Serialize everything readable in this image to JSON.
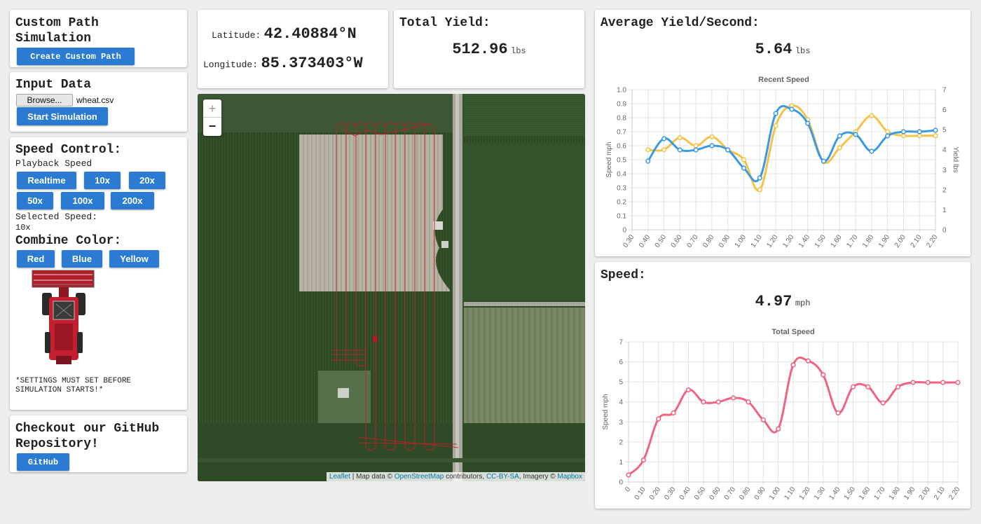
{
  "custom_path": {
    "title_line1": "Custom Path",
    "title_line2": "Simulation",
    "button": "Create Custom Path"
  },
  "input_data": {
    "title": "Input Data",
    "browse_label": "Browse...",
    "file_name": "wheat.csv",
    "start_button": "Start Simulation"
  },
  "speed_control": {
    "title": "Speed Control:",
    "playback_label": "Playback Speed",
    "buttons": [
      "Realtime",
      "10x",
      "20x",
      "50x",
      "100x",
      "200x"
    ],
    "selected_label": "Selected Speed:",
    "selected_value": "10x",
    "color_title": "Combine Color:",
    "color_buttons": [
      "Red",
      "Blue",
      "Yellow"
    ],
    "note_line1": "*SETTINGS MUST SET BEFORE",
    "note_line2": "SIMULATION STARTS!*"
  },
  "github": {
    "title_line1": "Checkout our GitHub",
    "title_line2": "Repository!",
    "button": "GitHub"
  },
  "coords": {
    "lat_label": "Latitude:",
    "lat_value": "42.40884°N",
    "lon_label": "Longitude:",
    "lon_value": "85.373403°W"
  },
  "total_yield": {
    "title": "Total Yield:",
    "value": "512.96",
    "unit": "lbs"
  },
  "avg_yield": {
    "title": "Average Yield/Second:",
    "value": "5.64",
    "unit": "lbs"
  },
  "speed": {
    "title": "Speed:",
    "value": "4.97",
    "unit": "mph"
  },
  "map": {
    "zoom_in": "+",
    "zoom_out": "−",
    "attr_leaflet": "Leaflet",
    "attr_text1": " | Map data © ",
    "attr_osm": "OpenStreetMap",
    "attr_text2": " contributors, ",
    "attr_license": "CC-BY-SA",
    "attr_text3": ", Imagery © ",
    "attr_mapbox": "Mapbox"
  },
  "colors": {
    "accent": "#2b7bd3",
    "yield_line": "#f5c24a",
    "speed_line_recent": "#3b9ae1",
    "speed_line_total": "#f06384",
    "path": "#c0202a"
  },
  "chart_data": [
    {
      "type": "line",
      "title": "Recent Speed",
      "ylabel": "Speed mph",
      "y2label": "Yield lbs",
      "categories": [
        "0.30",
        "0.40",
        "0.50",
        "0.60",
        "0.70",
        "0.80",
        "0.90",
        "1.00",
        "1.10",
        "1.20",
        "1.30",
        "1.40",
        "1.50",
        "1.60",
        "1.70",
        "1.80",
        "1.90",
        "2.00",
        "2.10",
        "2.20"
      ],
      "ylim": [
        0,
        1.0
      ],
      "y2lim": [
        0,
        7
      ],
      "yticks": [
        "0",
        "0.1",
        "0.2",
        "0.3",
        "0.4",
        "0.5",
        "0.6",
        "0.7",
        "0.8",
        "0.9",
        "1.0"
      ],
      "y2ticks": [
        "0",
        "1",
        "2",
        "3",
        "4",
        "5",
        "6",
        "7"
      ],
      "series": [
        {
          "axis": "right",
          "color": "#f5c24a",
          "values": [
            null,
            4.0,
            4.0,
            4.6,
            4.2,
            4.65,
            4.0,
            3.5,
            2.0,
            5.2,
            6.2,
            5.5,
            3.4,
            4.1,
            4.9,
            5.7,
            4.9,
            4.7,
            4.7,
            4.7
          ]
        },
        {
          "axis": "left",
          "color": "#3b9ae1",
          "values": [
            null,
            0.49,
            0.65,
            0.57,
            0.57,
            0.6,
            0.57,
            0.44,
            0.37,
            0.83,
            0.86,
            0.76,
            0.49,
            0.67,
            0.68,
            0.56,
            0.67,
            0.7,
            0.7,
            0.71
          ]
        }
      ],
      "grid": true
    },
    {
      "type": "line",
      "title": "Total Speed",
      "ylabel": "Speed mph",
      "categories": [
        "0",
        "0.10",
        "0.20",
        "0.30",
        "0.40",
        "0.50",
        "0.60",
        "0.70",
        "0.80",
        "0.90",
        "1.00",
        "1.10",
        "1.20",
        "1.30",
        "1.40",
        "1.50",
        "1.60",
        "1.70",
        "1.80",
        "1.90",
        "2.00",
        "2.10",
        "2.20"
      ],
      "ylim": [
        0,
        7
      ],
      "yticks": [
        "0",
        "1",
        "2",
        "3",
        "4",
        "5",
        "6",
        "7"
      ],
      "series": [
        {
          "color": "#f06384",
          "values": [
            0.35,
            1.1,
            3.15,
            3.45,
            4.6,
            4.0,
            4.0,
            4.2,
            4.0,
            3.1,
            2.65,
            5.85,
            6.05,
            5.35,
            3.45,
            4.75,
            4.75,
            3.95,
            4.75,
            4.97,
            4.97,
            4.97,
            4.97
          ]
        }
      ],
      "grid": true
    }
  ]
}
